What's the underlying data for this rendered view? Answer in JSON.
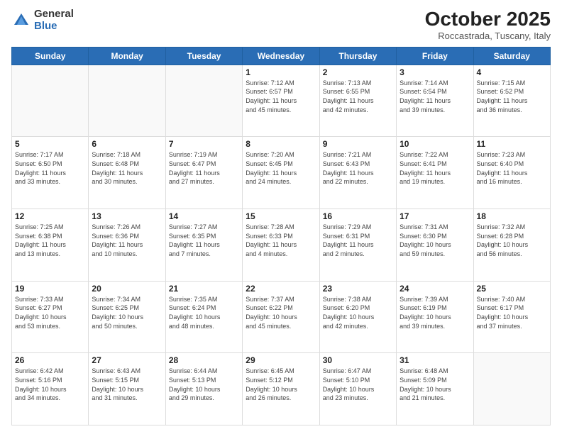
{
  "header": {
    "logo_general": "General",
    "logo_blue": "Blue",
    "month_title": "October 2025",
    "location": "Roccastrada, Tuscany, Italy"
  },
  "days_of_week": [
    "Sunday",
    "Monday",
    "Tuesday",
    "Wednesday",
    "Thursday",
    "Friday",
    "Saturday"
  ],
  "weeks": [
    [
      {
        "day": "",
        "info": ""
      },
      {
        "day": "",
        "info": ""
      },
      {
        "day": "",
        "info": ""
      },
      {
        "day": "1",
        "info": "Sunrise: 7:12 AM\nSunset: 6:57 PM\nDaylight: 11 hours\nand 45 minutes."
      },
      {
        "day": "2",
        "info": "Sunrise: 7:13 AM\nSunset: 6:55 PM\nDaylight: 11 hours\nand 42 minutes."
      },
      {
        "day": "3",
        "info": "Sunrise: 7:14 AM\nSunset: 6:54 PM\nDaylight: 11 hours\nand 39 minutes."
      },
      {
        "day": "4",
        "info": "Sunrise: 7:15 AM\nSunset: 6:52 PM\nDaylight: 11 hours\nand 36 minutes."
      }
    ],
    [
      {
        "day": "5",
        "info": "Sunrise: 7:17 AM\nSunset: 6:50 PM\nDaylight: 11 hours\nand 33 minutes."
      },
      {
        "day": "6",
        "info": "Sunrise: 7:18 AM\nSunset: 6:48 PM\nDaylight: 11 hours\nand 30 minutes."
      },
      {
        "day": "7",
        "info": "Sunrise: 7:19 AM\nSunset: 6:47 PM\nDaylight: 11 hours\nand 27 minutes."
      },
      {
        "day": "8",
        "info": "Sunrise: 7:20 AM\nSunset: 6:45 PM\nDaylight: 11 hours\nand 24 minutes."
      },
      {
        "day": "9",
        "info": "Sunrise: 7:21 AM\nSunset: 6:43 PM\nDaylight: 11 hours\nand 22 minutes."
      },
      {
        "day": "10",
        "info": "Sunrise: 7:22 AM\nSunset: 6:41 PM\nDaylight: 11 hours\nand 19 minutes."
      },
      {
        "day": "11",
        "info": "Sunrise: 7:23 AM\nSunset: 6:40 PM\nDaylight: 11 hours\nand 16 minutes."
      }
    ],
    [
      {
        "day": "12",
        "info": "Sunrise: 7:25 AM\nSunset: 6:38 PM\nDaylight: 11 hours\nand 13 minutes."
      },
      {
        "day": "13",
        "info": "Sunrise: 7:26 AM\nSunset: 6:36 PM\nDaylight: 11 hours\nand 10 minutes."
      },
      {
        "day": "14",
        "info": "Sunrise: 7:27 AM\nSunset: 6:35 PM\nDaylight: 11 hours\nand 7 minutes."
      },
      {
        "day": "15",
        "info": "Sunrise: 7:28 AM\nSunset: 6:33 PM\nDaylight: 11 hours\nand 4 minutes."
      },
      {
        "day": "16",
        "info": "Sunrise: 7:29 AM\nSunset: 6:31 PM\nDaylight: 11 hours\nand 2 minutes."
      },
      {
        "day": "17",
        "info": "Sunrise: 7:31 AM\nSunset: 6:30 PM\nDaylight: 10 hours\nand 59 minutes."
      },
      {
        "day": "18",
        "info": "Sunrise: 7:32 AM\nSunset: 6:28 PM\nDaylight: 10 hours\nand 56 minutes."
      }
    ],
    [
      {
        "day": "19",
        "info": "Sunrise: 7:33 AM\nSunset: 6:27 PM\nDaylight: 10 hours\nand 53 minutes."
      },
      {
        "day": "20",
        "info": "Sunrise: 7:34 AM\nSunset: 6:25 PM\nDaylight: 10 hours\nand 50 minutes."
      },
      {
        "day": "21",
        "info": "Sunrise: 7:35 AM\nSunset: 6:24 PM\nDaylight: 10 hours\nand 48 minutes."
      },
      {
        "day": "22",
        "info": "Sunrise: 7:37 AM\nSunset: 6:22 PM\nDaylight: 10 hours\nand 45 minutes."
      },
      {
        "day": "23",
        "info": "Sunrise: 7:38 AM\nSunset: 6:20 PM\nDaylight: 10 hours\nand 42 minutes."
      },
      {
        "day": "24",
        "info": "Sunrise: 7:39 AM\nSunset: 6:19 PM\nDaylight: 10 hours\nand 39 minutes."
      },
      {
        "day": "25",
        "info": "Sunrise: 7:40 AM\nSunset: 6:17 PM\nDaylight: 10 hours\nand 37 minutes."
      }
    ],
    [
      {
        "day": "26",
        "info": "Sunrise: 6:42 AM\nSunset: 5:16 PM\nDaylight: 10 hours\nand 34 minutes."
      },
      {
        "day": "27",
        "info": "Sunrise: 6:43 AM\nSunset: 5:15 PM\nDaylight: 10 hours\nand 31 minutes."
      },
      {
        "day": "28",
        "info": "Sunrise: 6:44 AM\nSunset: 5:13 PM\nDaylight: 10 hours\nand 29 minutes."
      },
      {
        "day": "29",
        "info": "Sunrise: 6:45 AM\nSunset: 5:12 PM\nDaylight: 10 hours\nand 26 minutes."
      },
      {
        "day": "30",
        "info": "Sunrise: 6:47 AM\nSunset: 5:10 PM\nDaylight: 10 hours\nand 23 minutes."
      },
      {
        "day": "31",
        "info": "Sunrise: 6:48 AM\nSunset: 5:09 PM\nDaylight: 10 hours\nand 21 minutes."
      },
      {
        "day": "",
        "info": ""
      }
    ]
  ]
}
